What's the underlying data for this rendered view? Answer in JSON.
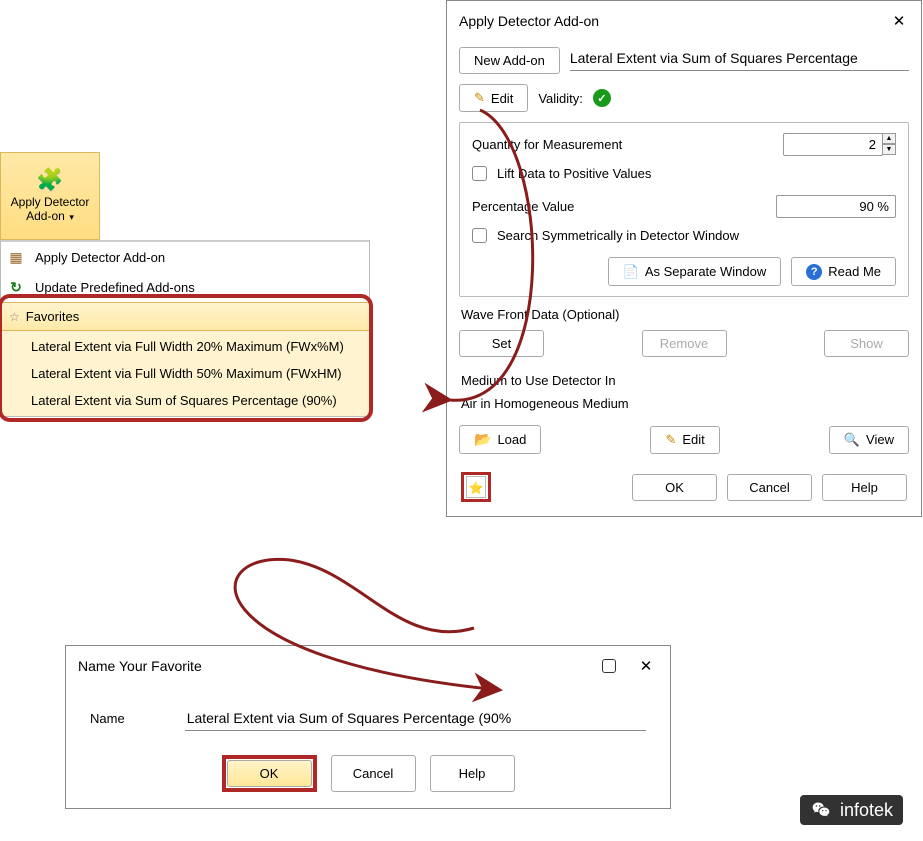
{
  "ribbon": {
    "label_line1": "Apply Detector",
    "label_line2": "Add-on"
  },
  "menu": {
    "item_apply": "Apply Detector Add-on",
    "item_update": "Update Predefined Add-ons",
    "favorites_label": "Favorites",
    "fav1": "Lateral Extent via Full Width 20% Maximum (FWx%M)",
    "fav2": "Lateral Extent via Full Width 50% Maximum (FWxHM)",
    "fav3": "Lateral Extent via Sum of Squares Percentage (90%)"
  },
  "dialog": {
    "title": "Apply Detector Add-on",
    "new_addon": "New Add-on",
    "addon_name": "Lateral Extent via Sum of Squares Percentage",
    "edit": "Edit",
    "validity_label": "Validity:",
    "quantity_label": "Quantity for Measurement",
    "quantity_value": "2",
    "lift_label": "Lift Data to Positive Values",
    "percentage_label": "Percentage Value",
    "percentage_value": "90 %",
    "search_label": "Search Symmetrically in Detector Window",
    "as_separate": "As Separate Window",
    "readme": "Read Me",
    "wavefront_title": "Wave Front Data (Optional)",
    "set": "Set",
    "remove": "Remove",
    "show": "Show",
    "medium_title": "Medium to Use Detector In",
    "medium_value": "Air in Homogeneous Medium",
    "load": "Load",
    "edit2": "Edit",
    "view": "View",
    "ok": "OK",
    "cancel": "Cancel",
    "help": "Help"
  },
  "favdlg": {
    "title": "Name Your Favorite",
    "name_label": "Name",
    "name_value": "Lateral Extent via Sum of Squares Percentage (90%",
    "ok": "OK",
    "cancel": "Cancel",
    "help": "Help"
  },
  "watermark": "infotek"
}
